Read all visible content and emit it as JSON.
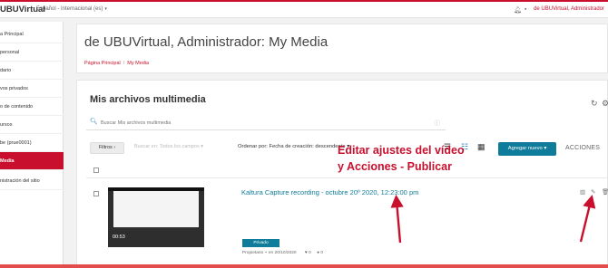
{
  "topbar": {
    "brand": "UBUVirtual",
    "language": "Español - Internacional (es)",
    "user": "de UBUVirtual, Administrador",
    "icons": [
      "bell-icon",
      "chat-icon"
    ]
  },
  "sidebar": {
    "items": [
      {
        "label": "a Principal",
        "active": false
      },
      {
        "label": "personal",
        "active": false
      },
      {
        "label": "dario",
        "active": false
      },
      {
        "label": "vos privados",
        "active": false
      },
      {
        "label": "o de contenido",
        "active": false
      },
      {
        "label": "ursos",
        "active": false
      },
      {
        "label": "be (prue0001)",
        "active": false
      },
      {
        "label": "Media",
        "active": true
      },
      {
        "label": "nistración del sitio",
        "active": false
      }
    ]
  },
  "header": {
    "title": "de UBUVirtual, Administrador: My Media",
    "breadcrumb": [
      "Página Principal",
      "My Media"
    ]
  },
  "main": {
    "title": "Mis archivos multimedia",
    "search_placeholder": "Buscar Mis archivos multimedia",
    "filters_label": "Filtros",
    "search_in": "Buscar en: Todos los campos",
    "order_label": "Ordenar por: Fecha de creación: descendente",
    "add_label": "Agregar nuevo",
    "actions_label": "ACCIONES"
  },
  "entry": {
    "title": "Kaltura Capture recording - octubre 20º 2020, 12:23:00 pm",
    "duration": "00:53",
    "status": "Privado",
    "owner": "Propietario",
    "date": "en 20/10/2020",
    "likes": "0",
    "comments": "0"
  },
  "annotation": {
    "line1": "Editar ajustes del vídeo",
    "line2": "y Acciones - Publicar",
    "color": "#c8102e"
  },
  "colors": {
    "accent": "#c8102e",
    "primary": "#0e7c9a",
    "link": "#2a7fb6"
  }
}
